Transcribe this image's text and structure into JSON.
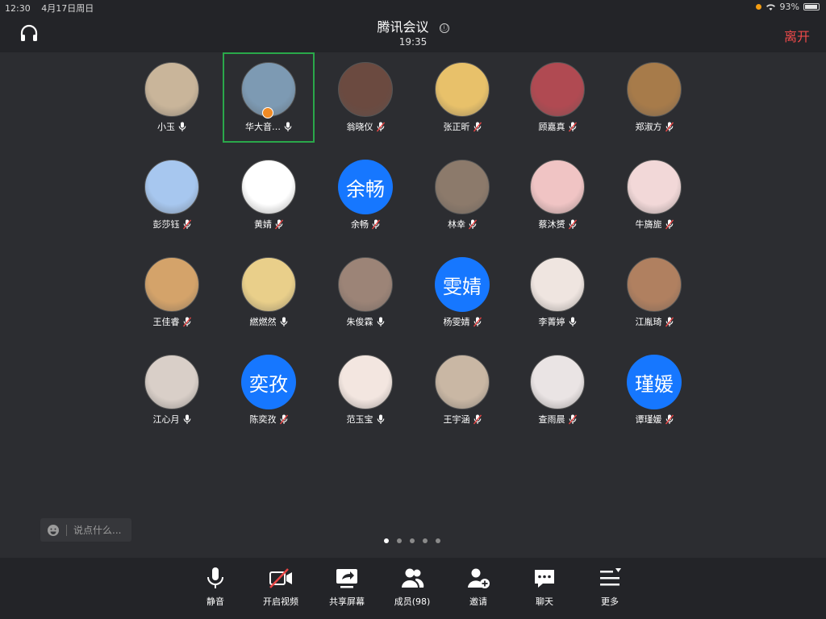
{
  "status": {
    "time": "12:30",
    "date": "4月17日周日",
    "battery": "93%",
    "battery_level": 0.93
  },
  "header": {
    "title": "腾讯会议",
    "time": "19:35",
    "leave": "离开",
    "info_icon": "ⓘ"
  },
  "participants": [
    {
      "name": "小玉",
      "muted": false,
      "avatar_color": "#c9b59a"
    },
    {
      "name": "华大音…",
      "muted": false,
      "active": true,
      "host": true,
      "avatar_color": "#7d9ab3"
    },
    {
      "name": "翁晓仪",
      "muted": true,
      "avatar_color": "#6b4a40"
    },
    {
      "name": "张正昕",
      "muted": true,
      "avatar_color": "#e8c16a"
    },
    {
      "name": "顾嘉真",
      "muted": true,
      "avatar_color": "#b04a52"
    },
    {
      "name": "郑淑方",
      "muted": true,
      "avatar_color": "#a77b4a"
    },
    {
      "name": "彭莎钰",
      "muted": true,
      "avatar_color": "#a7c7ef"
    },
    {
      "name": "黄婧",
      "muted": true,
      "avatar_color": "#ffffff"
    },
    {
      "name": "余畅",
      "muted": true,
      "avatar_text": "余畅"
    },
    {
      "name": "林幸",
      "muted": true,
      "avatar_color": "#8c7a6b"
    },
    {
      "name": "蔡沐赟",
      "muted": true,
      "avatar_color": "#f0c4c4"
    },
    {
      "name": "牛旖旎",
      "muted": true,
      "avatar_color": "#f2d8d8"
    },
    {
      "name": "王佳睿",
      "muted": true,
      "avatar_color": "#d4a36a"
    },
    {
      "name": "繎燃然",
      "muted": false,
      "avatar_color": "#e9cf8a"
    },
    {
      "name": "朱俊霖",
      "muted": false,
      "avatar_color": "#9c8477"
    },
    {
      "name": "杨雯婧",
      "muted": true,
      "avatar_text": "雯婧"
    },
    {
      "name": "李菁婷",
      "muted": false,
      "avatar_color": "#efe5e0"
    },
    {
      "name": "江胤琦",
      "muted": true,
      "avatar_color": "#b08060"
    },
    {
      "name": "江心月",
      "muted": false,
      "avatar_color": "#d9cfc8"
    },
    {
      "name": "陈奕孜",
      "muted": true,
      "avatar_text": "奕孜"
    },
    {
      "name": "范玉宝",
      "muted": false,
      "avatar_color": "#f3e6e0"
    },
    {
      "name": "王宇涵",
      "muted": true,
      "avatar_color": "#c9b7a4"
    },
    {
      "name": "查雨晨",
      "muted": true,
      "avatar_color": "#eae4e4"
    },
    {
      "name": "谭瑾媛",
      "muted": true,
      "avatar_text": "瑾媛"
    }
  ],
  "chat": {
    "placeholder": "说点什么..."
  },
  "pages": {
    "count": 5,
    "current": 1
  },
  "toolbar": [
    {
      "label": "静音",
      "icon": "microphone-icon"
    },
    {
      "label": "开启视频",
      "icon": "video-off-icon"
    },
    {
      "label": "共享屏幕",
      "icon": "share-screen-icon"
    },
    {
      "label": "成员(98)",
      "icon": "members-icon"
    },
    {
      "label": "邀请",
      "icon": "invite-icon"
    },
    {
      "label": "聊天",
      "icon": "chat-icon"
    },
    {
      "label": "更多",
      "icon": "more-icon"
    }
  ],
  "colors": {
    "accent_leave": "#ef4a4a",
    "active_border": "#2aa84a",
    "avatar_blue": "#1677ff"
  }
}
